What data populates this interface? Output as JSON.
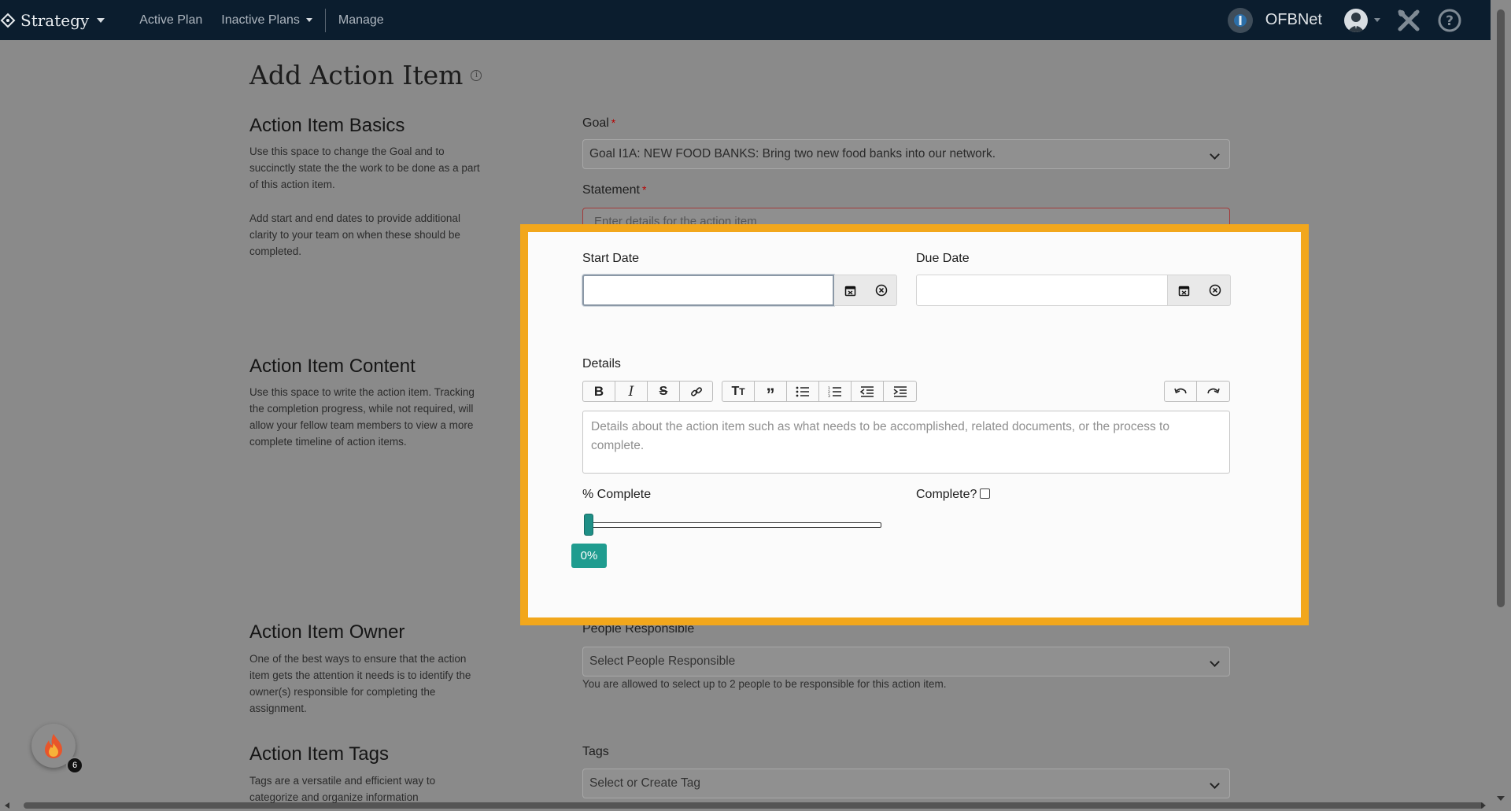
{
  "navbar": {
    "brand": "Strategy",
    "links": [
      "Active Plan",
      "Inactive Plans",
      "Manage"
    ],
    "org_name": "OFBNet"
  },
  "page": {
    "title": "Add Action Item"
  },
  "sections": {
    "basics": {
      "heading": "Action Item Basics",
      "desc1": "Use this space to change the Goal and to succinctly state the the work to be done as a part of this action item.",
      "desc2": "Add start and end dates to provide additional clarity to your team on when these should be completed."
    },
    "content": {
      "heading": "Action Item Content",
      "desc": "Use this space to write the action item. Tracking the completion progress, while not required, will allow your fellow team members to view a more complete timeline of action items."
    },
    "owner": {
      "heading": "Action Item Owner",
      "desc": "One of the best ways to ensure that the action item gets the attention it needs is to identify the owner(s) responsible for completing the assignment."
    },
    "tags": {
      "heading": "Action Item Tags",
      "desc": "Tags are a versatile and efficient way to categorize and organize information"
    }
  },
  "form": {
    "goal_label": "Goal",
    "goal_value": "Goal I1A: NEW FOOD BANKS: Bring two new food banks into our network.",
    "statement_label": "Statement",
    "statement_placeholder": "Enter details for the action item",
    "start_date_label": "Start Date",
    "due_date_label": "Due Date",
    "details_label": "Details",
    "details_placeholder": "Details about the action item such as what needs to be accomplished, related documents, or the process to complete.",
    "percent_label": "% Complete",
    "percent_value": 0,
    "percent_display": "0%",
    "complete_label": "Complete?",
    "people_label": "People Responsible",
    "people_placeholder": "Select People Responsible",
    "people_help": "You are allowed to select up to 2 people to be responsible for this action item.",
    "tags_label": "Tags",
    "tags_placeholder": "Select or Create Tag",
    "required_marker": "*"
  },
  "widget": {
    "badge_count": "6"
  },
  "colors": {
    "navbar": "#0b1d2e",
    "highlight": "#f2a71c",
    "teal": "#1f9c8f",
    "required": "#b80000"
  }
}
